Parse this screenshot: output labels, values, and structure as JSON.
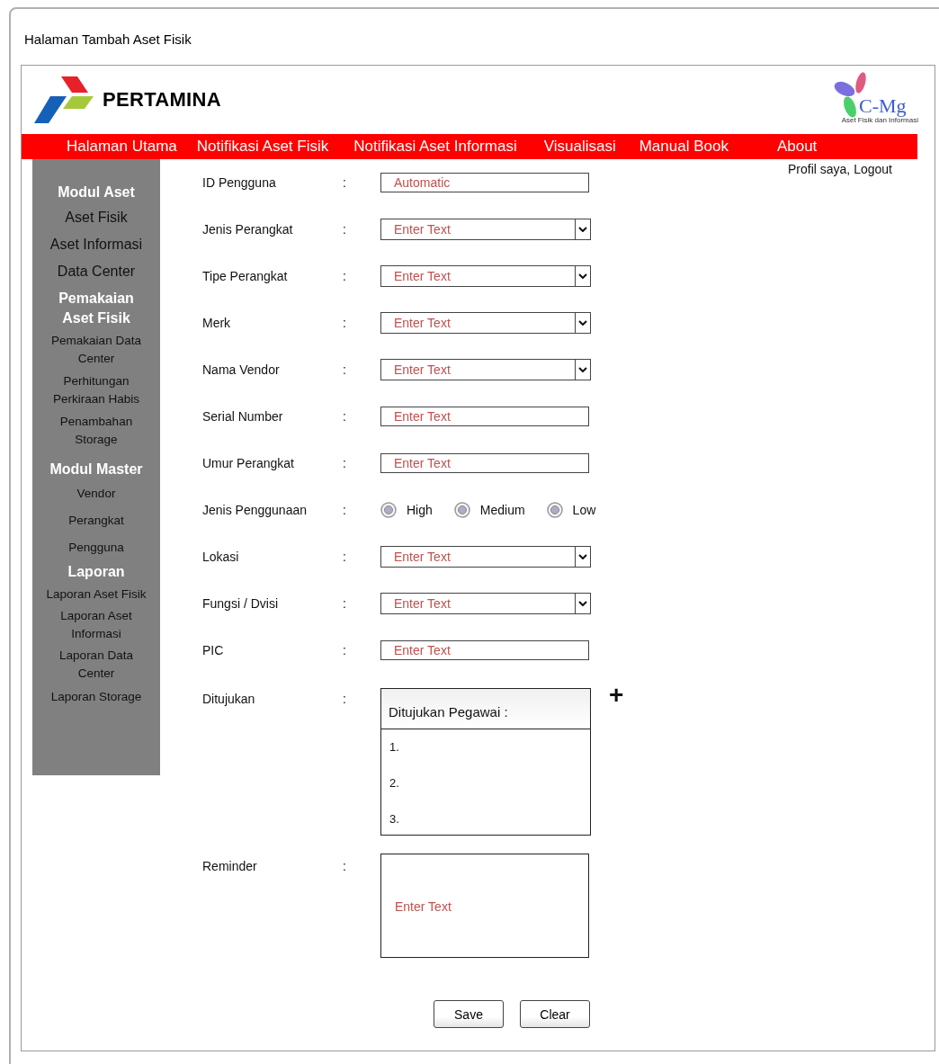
{
  "window": {
    "title": "Halaman Tambah Aset Fisik"
  },
  "header": {
    "brand": "PERTAMINA",
    "app_logo": {
      "name": "C-Mg",
      "tagline": "Aset Fisik dan Informasi"
    }
  },
  "nav": [
    "Halaman Utama",
    "Notifikasi Aset Fisik",
    "Notifikasi Aset Informasi",
    "Visualisasi",
    "Manual Book",
    "About"
  ],
  "user_links": "Profil saya, Logout",
  "sidebar": [
    {
      "kind": "heading",
      "text": "Modul Aset"
    },
    {
      "kind": "link",
      "text": "Aset Fisik"
    },
    {
      "kind": "link",
      "text": "Aset Informasi"
    },
    {
      "kind": "link",
      "text": "Data Center"
    },
    {
      "kind": "heading",
      "text": "Pemakaian Aset Fisik"
    },
    {
      "kind": "sublink",
      "text": "Pemakaian Data Center"
    },
    {
      "kind": "sublink",
      "text": "Perhitungan Perkiraan Habis"
    },
    {
      "kind": "sublink",
      "text": "Penambahan Storage"
    },
    {
      "kind": "heading",
      "text": "Modul Master"
    },
    {
      "kind": "sublink",
      "text": "Vendor"
    },
    {
      "kind": "sublink",
      "text": "Perangkat"
    },
    {
      "kind": "sublink",
      "text": "Pengguna"
    },
    {
      "kind": "heading",
      "text": "Laporan"
    },
    {
      "kind": "sublink",
      "text": "Laporan Aset Fisik"
    },
    {
      "kind": "sublink",
      "text": "Laporan Aset Informasi"
    },
    {
      "kind": "sublink",
      "text": "Laporan Data Center"
    },
    {
      "kind": "sublink",
      "text": "Laporan Storage"
    }
  ],
  "form": {
    "fields": [
      {
        "kind": "text",
        "label": "ID Pengguna",
        "colon": ":",
        "value": "Automatic"
      },
      {
        "kind": "dropdown",
        "label": "Jenis Perangkat",
        "colon": ":",
        "placeholder": "Enter Text"
      },
      {
        "kind": "dropdown",
        "label": "Tipe Perangkat",
        "colon": ":",
        "placeholder": "Enter Text"
      },
      {
        "kind": "dropdown",
        "label": "Merk",
        "colon": ":",
        "placeholder": "Enter Text"
      },
      {
        "kind": "dropdown",
        "label": "Nama Vendor",
        "colon": ":",
        "placeholder": "Enter Text"
      },
      {
        "kind": "text",
        "label": "Serial Number",
        "colon": ":",
        "placeholder": "Enter Text"
      },
      {
        "kind": "text",
        "label": "Umur Perangkat",
        "colon": ":",
        "placeholder": "Enter Text"
      },
      {
        "kind": "radio",
        "label": "Jenis Penggunaan",
        "colon": ":",
        "options": [
          {
            "label": "High",
            "selected": false
          },
          {
            "label": "Medium",
            "selected": false
          },
          {
            "label": "Low",
            "selected": false
          }
        ]
      },
      {
        "kind": "dropdown",
        "label": "Lokasi",
        "colon": ":",
        "placeholder": "Enter Text"
      },
      {
        "kind": "dropdown",
        "label": "Fungsi / Dvisi",
        "colon": ":",
        "placeholder": "Enter Text"
      },
      {
        "kind": "text",
        "label": "PIC",
        "colon": ":",
        "placeholder": "Enter Text"
      },
      {
        "kind": "list",
        "label": "Ditujukan",
        "colon": ":",
        "title": "Ditujukan Pegawai :",
        "items": [
          "1.",
          "2.",
          "3."
        ],
        "add": "+"
      },
      {
        "kind": "textarea",
        "label": "Reminder",
        "colon": ":",
        "placeholder": "Enter Text"
      }
    ],
    "buttons": [
      "Save",
      "Clear"
    ]
  }
}
